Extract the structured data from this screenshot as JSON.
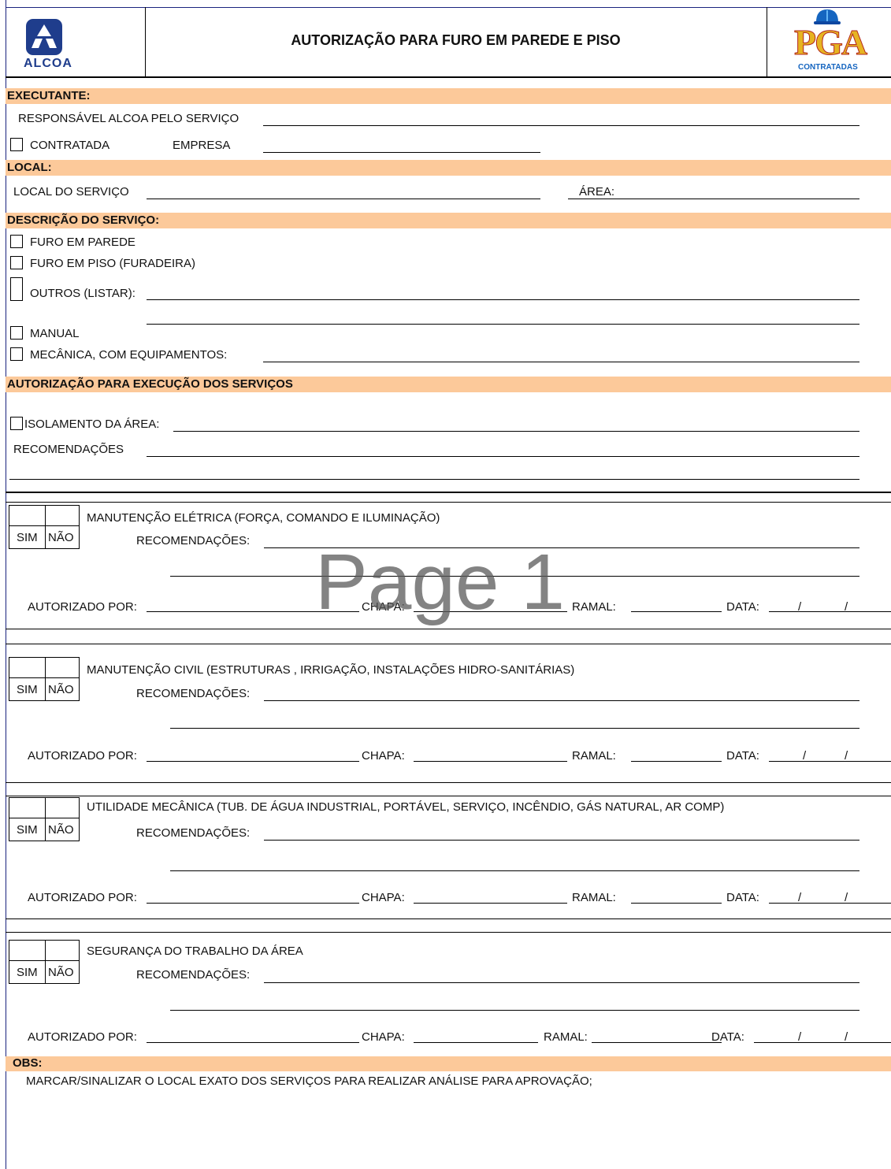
{
  "header": {
    "logo_left_text": "ALCOA",
    "title": "AUTORIZAÇÃO PARA FURO EM PAREDE E PISO",
    "logo_right_text": "PGA",
    "logo_right_sub": "CONTRATADAS"
  },
  "executante": {
    "heading": "EXECUTANTE:",
    "responsavel_label": "RESPONSÁVEL ALCOA PELO SERVIÇO",
    "contratada_label": "CONTRATADA",
    "empresa_label": "EMPRESA"
  },
  "local": {
    "heading": "LOCAL:",
    "local_label": "LOCAL DO SERVIÇO",
    "area_label": "ÁREA:"
  },
  "descricao": {
    "heading": "DESCRIÇÃO DO SERVIÇO:",
    "opt1": "FURO EM PAREDE",
    "opt2": "FURO EM PISO (FURADEIRA)",
    "opt3": "OUTROS (LISTAR):",
    "opt4": "MANUAL",
    "opt5": "MECÂNICA, COM EQUIPAMENTOS:"
  },
  "autorizacao": {
    "heading": "AUTORIZAÇÃO PARA EXECUÇÃO DOS SERVIÇOS",
    "isolamento_label": "ISOLAMENTO DA ÁREA:",
    "recomendacoes_label": "RECOMENDAÇÕES"
  },
  "sections": [
    {
      "title": "MANUTENÇÃO ELÉTRICA (FORÇA, COMANDO E ILUMINAÇÃO)"
    },
    {
      "title": "MANUTENÇÃO CIVIL (ESTRUTURAS , IRRIGAÇÃO, INSTALAÇÕES HIDRO-SANITÁRIAS)"
    },
    {
      "title": "UTILIDADE MECÂNICA (TUB. DE ÁGUA INDUSTRIAL, PORTÁVEL, SERVIÇO, INCÊNDIO, GÁS NATURAL, AR COMP)"
    },
    {
      "title": "SEGURANÇA DO TRABALHO DA ÁREA"
    }
  ],
  "common": {
    "sim": "SIM",
    "nao": "NÃO",
    "recomendacoes": "RECOMENDAÇÕES:",
    "autorizado": "AUTORIZADO POR:",
    "chapa": "CHAPA:",
    "ramal": "RAMAL:",
    "data": "DATA:",
    "slash": "/"
  },
  "obs": {
    "heading": "OBS:",
    "text": "MARCAR/SINALIZAR O LOCAL EXATO DOS SERVIÇOS PARA REALIZAR ANÁLISE PARA APROVAÇÃO;"
  },
  "watermark": "Page 1",
  "colors": {
    "section_bar": "#fcc99a",
    "alcoa_blue": "#1f3d8c"
  }
}
